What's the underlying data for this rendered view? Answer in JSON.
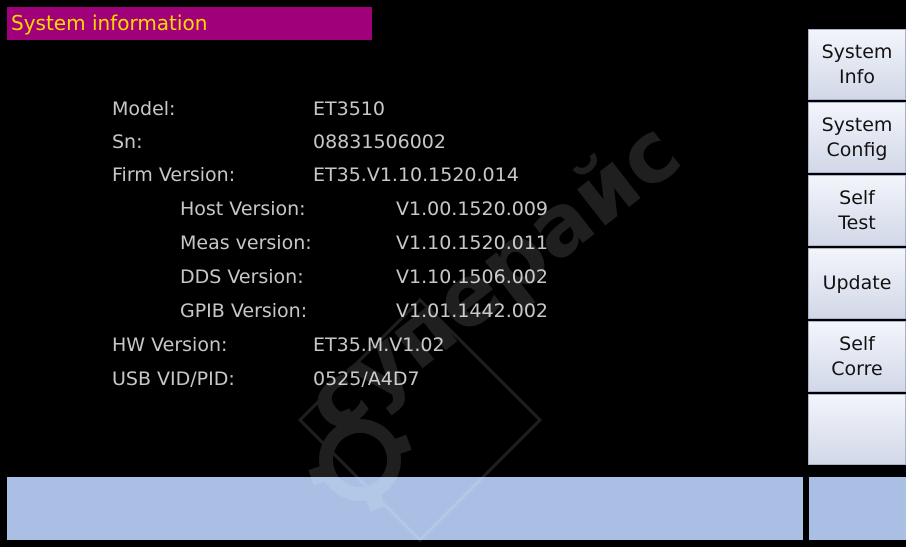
{
  "title": "System information",
  "info": {
    "model": {
      "label": "Model:",
      "value": "ET3510"
    },
    "sn": {
      "label": "Sn:",
      "value": "08831506002"
    },
    "firm": {
      "label": "Firm Version:",
      "value": "ET35.V1.10.1520.014"
    },
    "host": {
      "label": "Host Version:",
      "value": "V1.00.1520.009"
    },
    "meas": {
      "label": "Meas version:",
      "value": "V1.10.1520.011"
    },
    "dds": {
      "label": "DDS Version:",
      "value": "V1.10.1506.002"
    },
    "gpib": {
      "label": "GPIB Version:",
      "value": "V1.01.1442.002"
    },
    "hw": {
      "label": "HW Version:",
      "value": "ET35.M.V1.02"
    },
    "usb": {
      "label": "USB VID/PID:",
      "value": "0525/A4D7"
    }
  },
  "softkeys": {
    "system_info": {
      "line1": "System",
      "line2": "Info"
    },
    "system_config": {
      "line1": "System",
      "line2": "Config"
    },
    "self_test": {
      "line1": "Self",
      "line2": "Test"
    },
    "update": {
      "line1": "Update"
    },
    "self_corre": {
      "line1": "Self",
      "line2": "Corre"
    },
    "blank": {
      "line1": ""
    }
  },
  "watermark": {
    "text": "суперайс",
    "icon": "gear-icon"
  },
  "colors": {
    "title_bg": "#a0007a",
    "title_fg": "#ffd700",
    "text": "#c7c7c7",
    "bottom_bar": "#a9bfe3"
  }
}
